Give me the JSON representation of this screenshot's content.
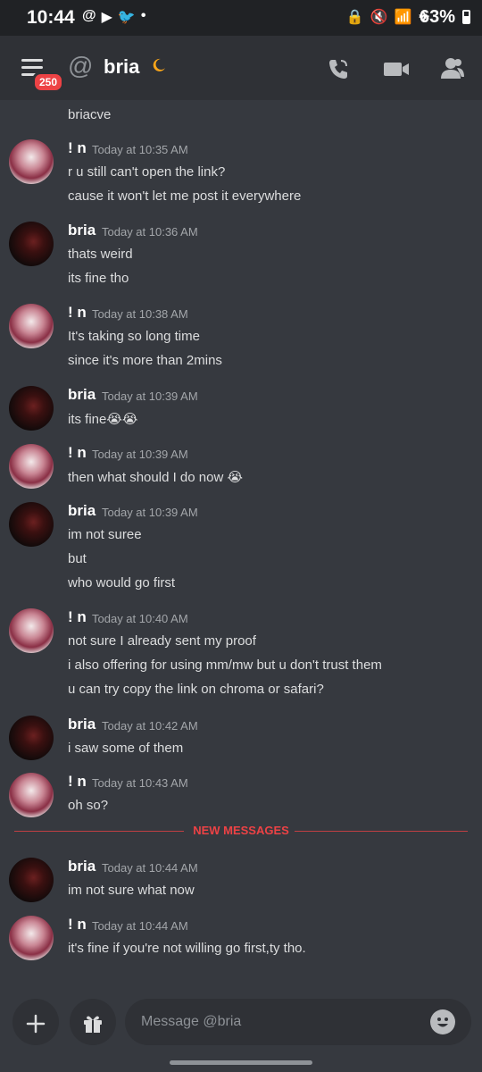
{
  "status_bar": {
    "time": "10:44",
    "battery": "63%",
    "left_icons": [
      "@",
      "▶",
      "🐦",
      "•"
    ],
    "right_icons": [
      "🔒",
      "🔇",
      "📶",
      "✈"
    ]
  },
  "header": {
    "title": "bria",
    "badge": "250",
    "at_symbol": "@"
  },
  "top_partial_line": "briacve",
  "messages": [
    {
      "author": "! n",
      "time": "Today at 10:35 AM",
      "avatar": "n",
      "lines": [
        "r u still can't open the link?",
        "cause it won't let me post it everywhere"
      ]
    },
    {
      "author": "bria",
      "time": "Today at 10:36 AM",
      "avatar": "bria",
      "lines": [
        "thats weird",
        "its fine tho"
      ]
    },
    {
      "author": "! n",
      "time": "Today at 10:38 AM",
      "avatar": "n",
      "lines": [
        "It's taking so long time",
        "since it's more than 2mins"
      ]
    },
    {
      "author": "bria",
      "time": "Today at 10:39 AM",
      "avatar": "bria",
      "lines": [
        "its fine😭😭"
      ]
    },
    {
      "author": "! n",
      "time": "Today at 10:39 AM",
      "avatar": "n",
      "lines": [
        "then what should I do now 😭"
      ]
    },
    {
      "author": "bria",
      "time": "Today at 10:39 AM",
      "avatar": "bria",
      "lines": [
        "im not suree",
        "but",
        "who would go first"
      ]
    },
    {
      "author": "! n",
      "time": "Today at 10:40 AM",
      "avatar": "n",
      "lines": [
        "not sure I already sent my proof",
        "i also offering for using mm/mw but u don't trust them",
        "u can try copy the link on chroma or safari?"
      ]
    },
    {
      "author": "bria",
      "time": "Today at 10:42 AM",
      "avatar": "bria",
      "lines": [
        "i saw some of them"
      ]
    },
    {
      "author": "! n",
      "time": "Today at 10:43 AM",
      "avatar": "n",
      "lines": [
        "oh so?"
      ]
    },
    {
      "author": "bria",
      "time": "Today at 10:44 AM",
      "avatar": "bria",
      "lines": [
        "im not sure what now"
      ]
    },
    {
      "author": "! n",
      "time": "Today at 10:44 AM",
      "avatar": "n",
      "lines": [
        "it's fine if you're not willing go first,ty tho."
      ]
    }
  ],
  "new_messages_label": "NEW MESSAGES",
  "composer": {
    "placeholder": "Message @bria"
  },
  "colors": {
    "background": "#36393f",
    "header": "#2f3136",
    "accent_red": "#ed4245",
    "moon": "#faa61a"
  }
}
